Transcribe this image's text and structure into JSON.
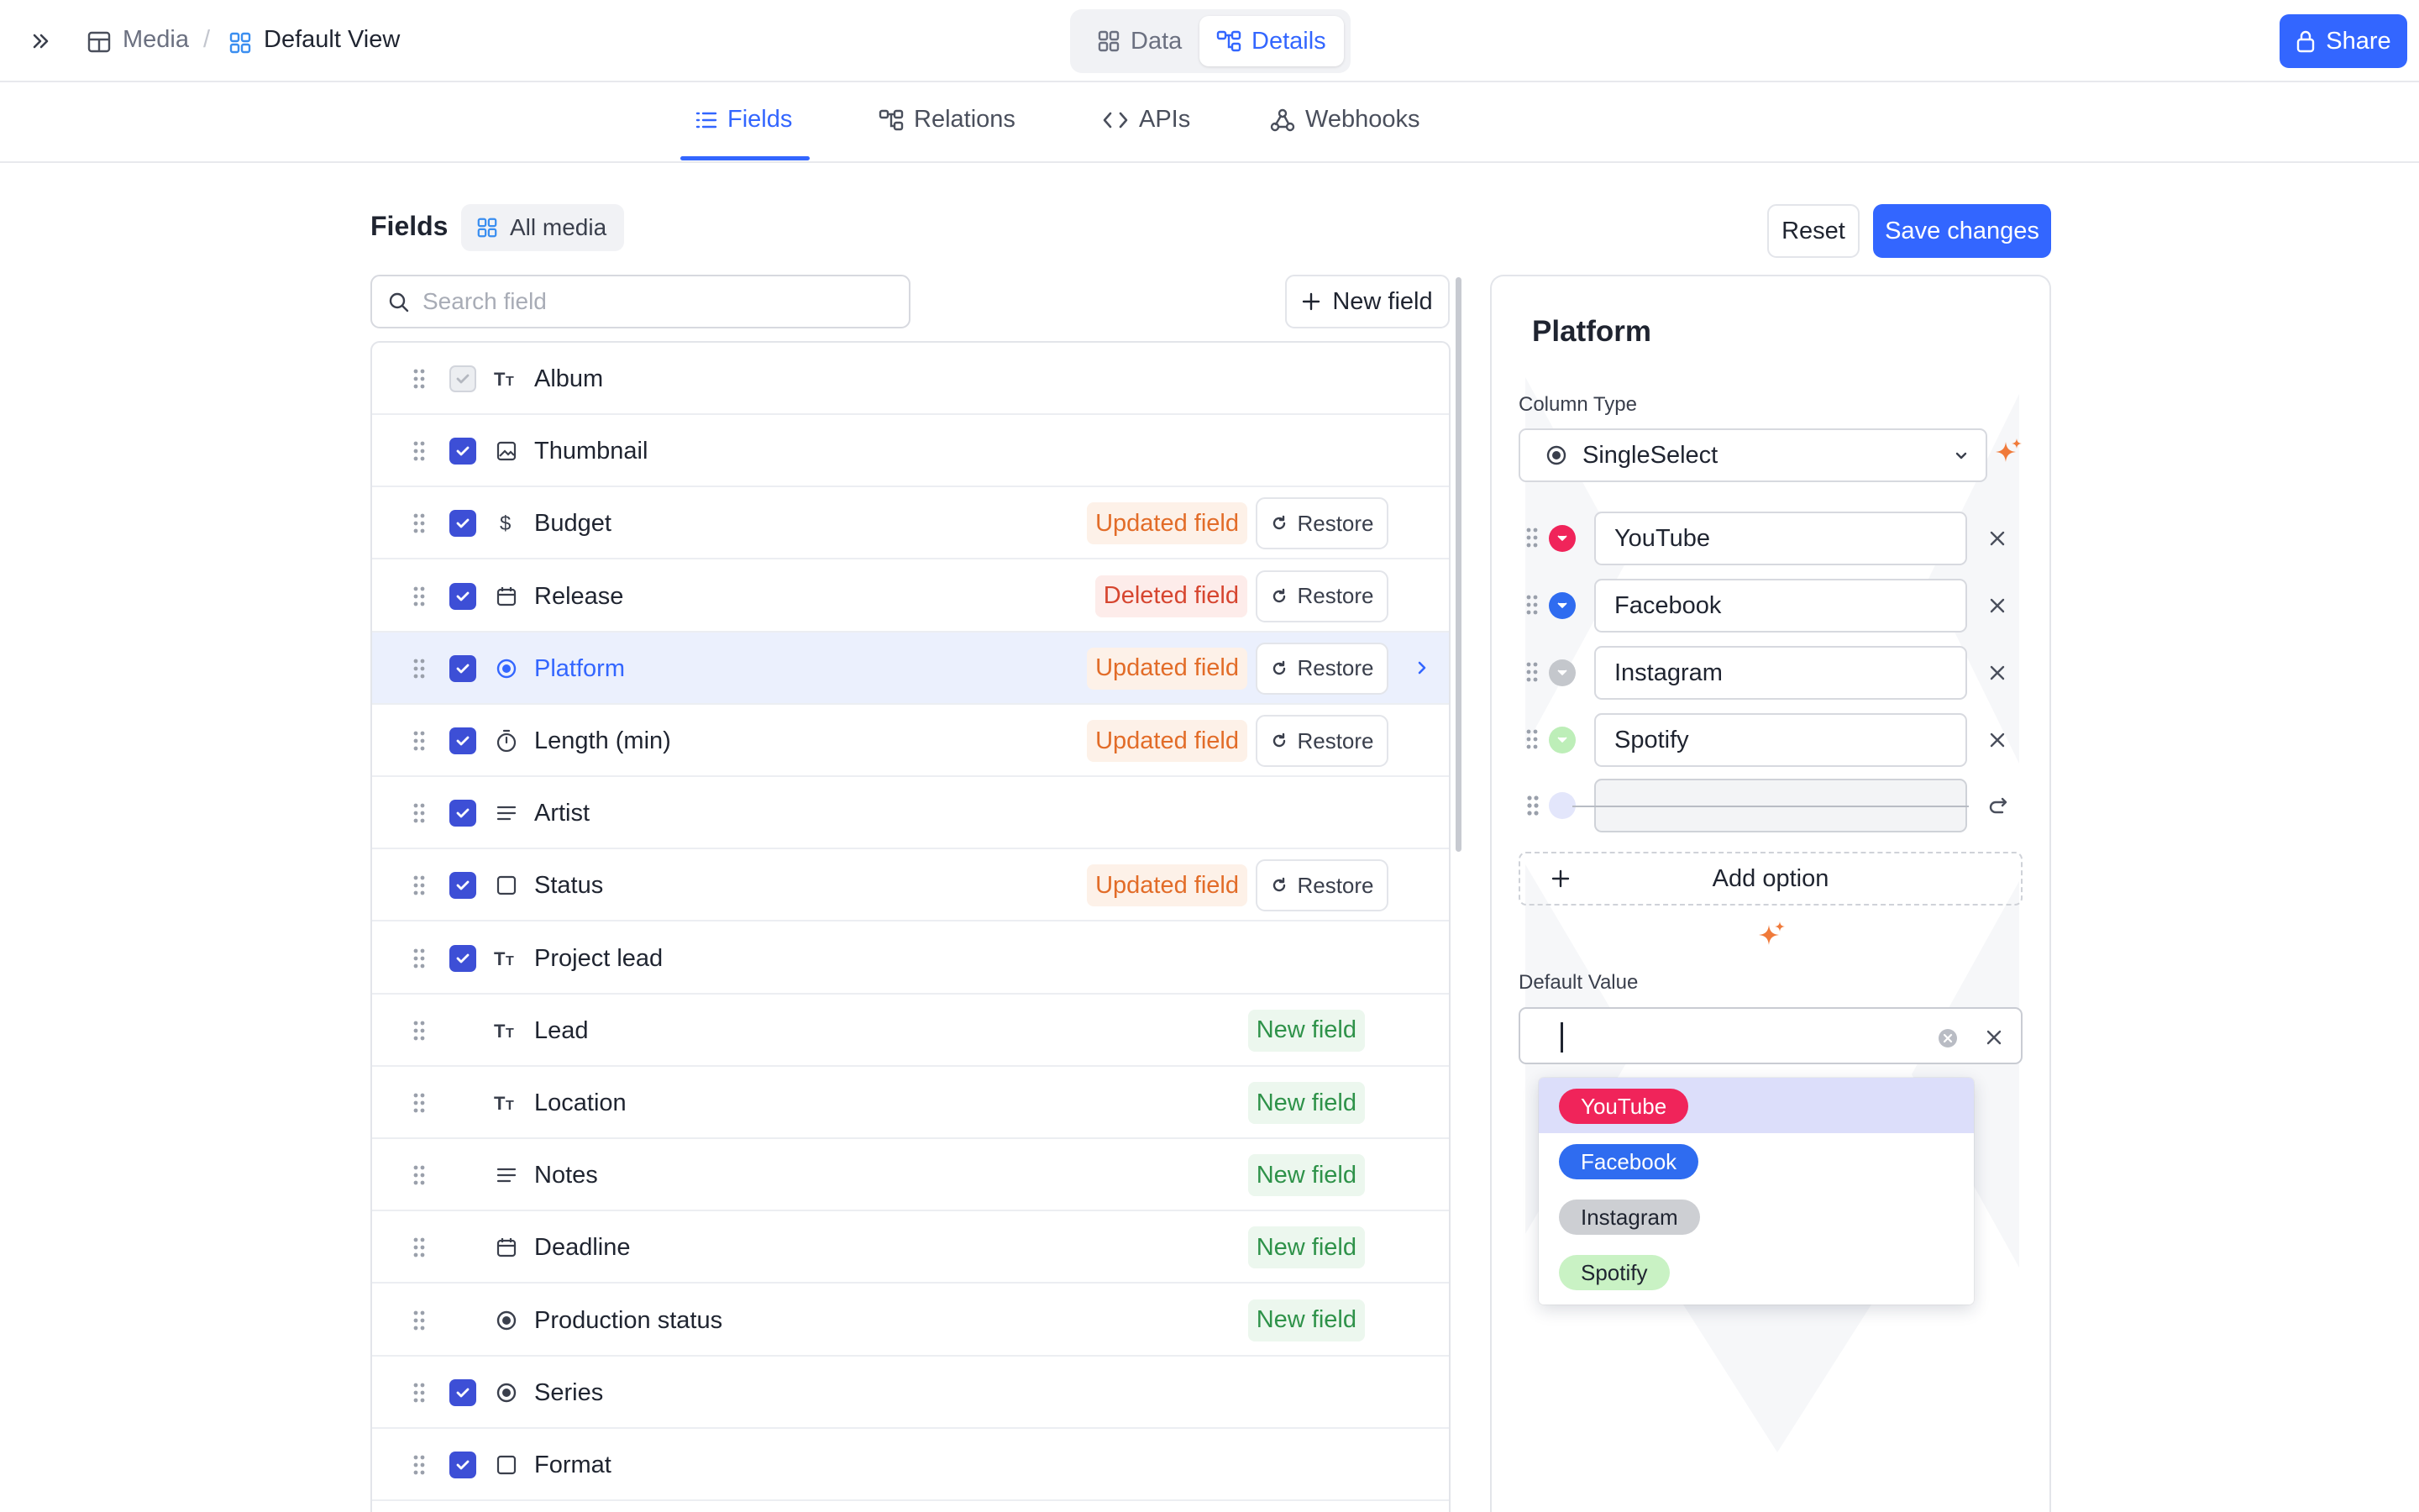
{
  "breadcrumb": {
    "base": "Media",
    "separator": "/",
    "view": "Default View"
  },
  "view_switch": {
    "data_label": "Data",
    "details_label": "Details",
    "active": "Details"
  },
  "share_label": "Share",
  "tabs": [
    {
      "label": "Fields",
      "active": true,
      "icon": "list-icon"
    },
    {
      "label": "Relations",
      "active": false,
      "icon": "relations-icon"
    },
    {
      "label": "APIs",
      "active": false,
      "icon": "code-icon"
    },
    {
      "label": "Webhooks",
      "active": false,
      "icon": "webhook-icon"
    }
  ],
  "fields_header": {
    "title": "Fields",
    "scope_label": "All media"
  },
  "actions": {
    "reset_label": "Reset",
    "save_label": "Save changes"
  },
  "search": {
    "placeholder": "Search field",
    "value": ""
  },
  "new_field_label": "New field",
  "restore_label": "Restore",
  "fields": [
    {
      "name": "Album",
      "icon": "text-icon",
      "checked": true,
      "disabled": true,
      "badge": ""
    },
    {
      "name": "Thumbnail",
      "icon": "image-icon",
      "checked": true,
      "badge": ""
    },
    {
      "name": "Budget",
      "icon": "dollar-icon",
      "checked": true,
      "badge": "Updated field",
      "badge_type": "updated",
      "restore": true
    },
    {
      "name": "Release",
      "icon": "calendar-icon",
      "checked": true,
      "badge": "Deleted field",
      "badge_type": "deleted",
      "restore": true
    },
    {
      "name": "Platform",
      "icon": "single-select-icon",
      "checked": true,
      "badge": "Updated field",
      "badge_type": "updated",
      "restore": true,
      "selected": true
    },
    {
      "name": "Length (min)",
      "icon": "timer-icon",
      "checked": true,
      "badge": "Updated field",
      "badge_type": "updated",
      "restore": true
    },
    {
      "name": "Artist",
      "icon": "long-text-icon",
      "checked": true,
      "badge": ""
    },
    {
      "name": "Status",
      "icon": "checkbox-icon",
      "checked": true,
      "badge": "Updated field",
      "badge_type": "updated",
      "restore": true
    },
    {
      "name": "Project lead",
      "icon": "text-icon",
      "checked": true,
      "badge": ""
    },
    {
      "name": "Lead",
      "icon": "text-icon",
      "checked": false,
      "badge": "New field",
      "badge_type": "new"
    },
    {
      "name": "Location",
      "icon": "text-icon",
      "checked": false,
      "badge": "New field",
      "badge_type": "new"
    },
    {
      "name": "Notes",
      "icon": "long-text-icon",
      "checked": false,
      "badge": "New field",
      "badge_type": "new"
    },
    {
      "name": "Deadline",
      "icon": "calendar-icon",
      "checked": false,
      "badge": "New field",
      "badge_type": "new"
    },
    {
      "name": "Production status",
      "icon": "single-select-icon",
      "checked": false,
      "badge": "New field",
      "badge_type": "new"
    },
    {
      "name": "Series",
      "icon": "single-select-icon",
      "checked": true,
      "badge": ""
    },
    {
      "name": "Format",
      "icon": "checkbox-icon",
      "checked": true,
      "badge": ""
    }
  ],
  "editor": {
    "title": "Platform",
    "column_type_label": "Column Type",
    "column_type_value": "SingleSelect",
    "options": [
      {
        "label": "YouTube",
        "color": "#f0245a"
      },
      {
        "label": "Facebook",
        "color": "#2f6cf0"
      },
      {
        "label": "Instagram",
        "color": "#c4c7cc"
      },
      {
        "label": "Spotify",
        "color": "#bdeeb8"
      }
    ],
    "add_option_label": "Add option",
    "default_value_label": "Default Value",
    "default_value": "",
    "dropdown": [
      {
        "label": "YouTube",
        "bg": "#f0245a",
        "fg": "#ffffff",
        "highlighted": true
      },
      {
        "label": "Facebook",
        "bg": "#2f6cf0",
        "fg": "#ffffff",
        "highlighted": false
      },
      {
        "label": "Instagram",
        "bg": "#cdcfd3",
        "fg": "#1f2430",
        "highlighted": false
      },
      {
        "label": "Spotify",
        "bg": "#c9f2c4",
        "fg": "#1f2430",
        "highlighted": false
      }
    ]
  },
  "colors": {
    "accent": "#3366ff",
    "checkbox": "#3d4fd6",
    "updated": "#e26c28",
    "deleted": "#d6452f",
    "new": "#2e9249"
  }
}
